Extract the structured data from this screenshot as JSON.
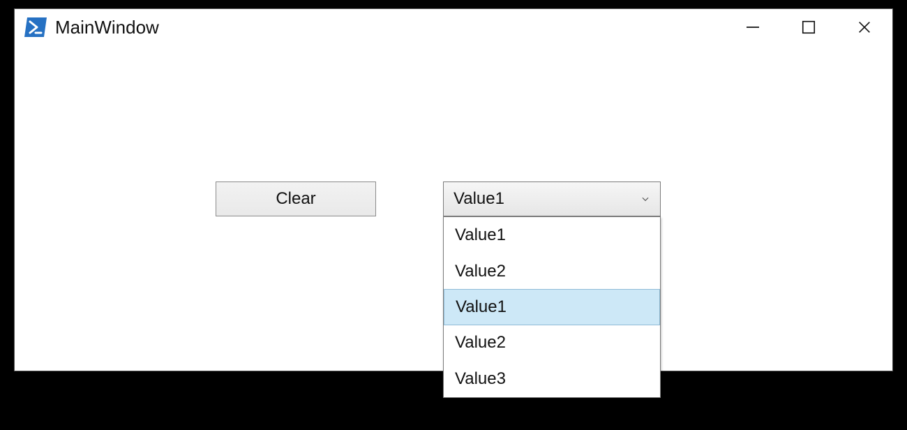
{
  "window": {
    "title": "MainWindow"
  },
  "actions": {
    "clear_label": "Clear"
  },
  "combo": {
    "selected": "Value1",
    "options": [
      {
        "label": "Value1",
        "highlighted": false
      },
      {
        "label": "Value2",
        "highlighted": false
      },
      {
        "label": "Value1",
        "highlighted": true
      },
      {
        "label": "Value2",
        "highlighted": false
      },
      {
        "label": "Value3",
        "highlighted": false
      }
    ]
  }
}
